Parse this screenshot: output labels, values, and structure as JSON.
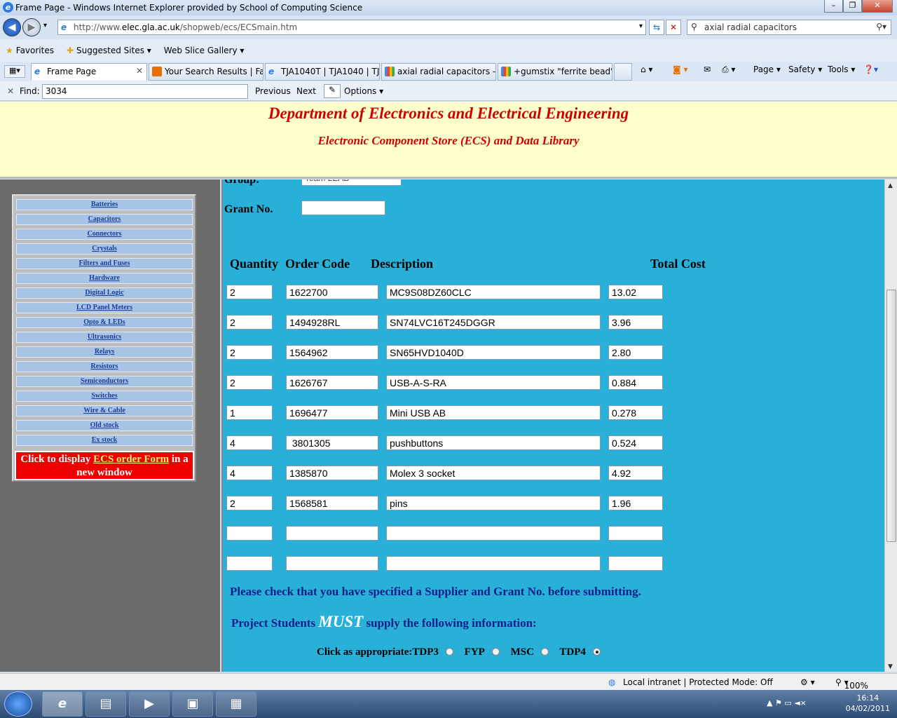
{
  "browser": {
    "window_title": "Frame Page - Windows Internet Explorer provided by School of Computing Science",
    "url_prefix": "http://www.",
    "url_host": "elec.gla.ac.uk",
    "url_path": "/shopweb/ecs/ECSmain.htm",
    "search_value": "axial radial capacitors",
    "favorites_label": "Favorites",
    "suggested_sites": "Suggested Sites ▾",
    "web_slice": "Web Slice Gallery ▾",
    "tabs": [
      {
        "label": "Frame Page"
      },
      {
        "label": "Your Search Results | Far..."
      },
      {
        "label": "TJA1040T | TJA1040 | TJ..."
      },
      {
        "label": "axial radial capacitors - ..."
      },
      {
        "label": "+gumstix \"ferrite bead\" ..."
      }
    ],
    "commands": {
      "page": "Page ▾",
      "safety": "Safety ▾",
      "tools": "Tools ▾"
    },
    "find": {
      "label": "Find:",
      "value": "3034",
      "previous": "Previous",
      "next": "Next",
      "options": "Options ▾"
    },
    "status_zone": "Local intranet | Protected Mode: Off",
    "zoom": "100%"
  },
  "banner": {
    "title": "Department of Electronics and Electrical Engineering",
    "subtitle": "Electronic Component Store (ECS) and Data Library"
  },
  "sidebar": {
    "items": [
      "Batteries",
      "Capacitors",
      "Connectors",
      "Crystals",
      "Filters and Fuses",
      "Hardware",
      "Digital Logic",
      "LCD Panel Meters",
      "Opto & LEDs",
      "Ultrasonics",
      "Relays",
      "Resistors",
      "Semiconductors",
      "Switches",
      "Wire & Cable",
      "Old stock",
      "Ex stock"
    ],
    "order_pre": "Click to display ",
    "order_link": "ECS order Form",
    "order_post": " in a new window"
  },
  "form": {
    "group_label": "Group:",
    "group_value": "Team LEAD",
    "grant_label": "Grant No.",
    "grant_value": "",
    "headers": {
      "quantity": "Quantity",
      "order_code": "Order Code",
      "description": "Description",
      "total_cost": "Total Cost"
    },
    "rows": [
      {
        "qty": "2",
        "code": "1622700",
        "desc": "MC9S08DZ60CLC",
        "cost": "13.02"
      },
      {
        "qty": "2",
        "code": "1494928RL",
        "desc": "SN74LVC16T245DGGR",
        "cost": "3.96"
      },
      {
        "qty": "2",
        "code": "1564962",
        "desc": "SN65HVD1040D",
        "cost": "2.80"
      },
      {
        "qty": "2",
        "code": "1626767",
        "desc": "USB-A-S-RA",
        "cost": "0.884"
      },
      {
        "qty": "1",
        "code": "1696477",
        "desc": "Mini USB AB",
        "cost": "0.278"
      },
      {
        "qty": "4",
        "code": " 3801305",
        "desc": "pushbuttons",
        "cost": "0.524"
      },
      {
        "qty": "4",
        "code": "1385870",
        "desc": "Molex 3 socket",
        "cost": "4.92"
      },
      {
        "qty": "2",
        "code": "1568581",
        "desc": "pins",
        "cost": "1.96"
      },
      {
        "qty": "",
        "code": "",
        "desc": "",
        "cost": ""
      },
      {
        "qty": "",
        "code": "",
        "desc": "",
        "cost": ""
      }
    ],
    "check_note": "Please check that you have specified a Supplier and Grant No. before submitting.",
    "project_pre": "Project Students ",
    "project_must": "MUST",
    "project_post": " supply the following information:",
    "click_label": "Click as appropriate:",
    "options": [
      {
        "label": "TDP3",
        "selected": false
      },
      {
        "label": "FYP",
        "selected": false
      },
      {
        "label": "MSC",
        "selected": false
      },
      {
        "label": "TDP4",
        "selected": true
      }
    ]
  },
  "taskbar": {
    "time": "16:14",
    "date": "04/02/2011"
  }
}
